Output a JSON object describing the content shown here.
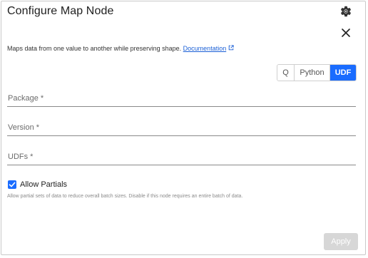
{
  "dialog": {
    "title": "Configure Map Node",
    "settings_icon": "gear-icon",
    "close_icon": "close-icon"
  },
  "description": {
    "text": "Maps data from one value to another while preserving shape.",
    "link_label": "Documentation",
    "link_icon": "external-link-icon"
  },
  "language_toggle": {
    "options": [
      "Q",
      "Python",
      "UDF"
    ],
    "selected": "UDF"
  },
  "fields": {
    "package_label": "Package *",
    "package_value": "",
    "version_label": "Version *",
    "version_value": "",
    "udfs_label": "UDFs *",
    "udfs_value": ""
  },
  "allow_partials": {
    "label": "Allow Partials",
    "checked": true,
    "help_text": "Allow partial sets of data to reduce overall batch sizes. Disable if this node requires an entire batch of data."
  },
  "footer": {
    "apply_label": "Apply",
    "apply_disabled": true
  },
  "colors": {
    "accent": "#1a6cff",
    "link": "#1a5fd6",
    "disabled_button": "#d7d7d7"
  }
}
